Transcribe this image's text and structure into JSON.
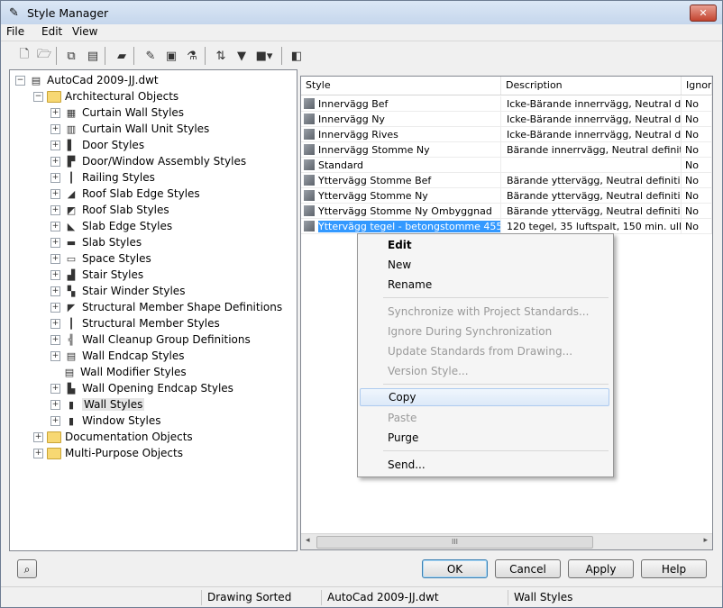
{
  "window": {
    "title": "Style Manager",
    "close_label": "✕"
  },
  "menu": [
    "File",
    "Edit",
    "View"
  ],
  "tree": {
    "root": "AutoCad 2009-JJ.dwt",
    "architectural": "Architectural Objects",
    "items": [
      "Curtain Wall Styles",
      "Curtain Wall Unit Styles",
      "Door Styles",
      "Door/Window Assembly Styles",
      "Railing Styles",
      "Roof Slab Edge Styles",
      "Roof Slab Styles",
      "Slab Edge Styles",
      "Slab Styles",
      "Space Styles",
      "Stair Styles",
      "Stair Winder Styles",
      "Structural Member Shape Definitions",
      "Structural Member Styles",
      "Wall Cleanup Group Definitions",
      "Wall Endcap Styles",
      "Wall Modifier Styles",
      "Wall Opening Endcap Styles",
      "Wall Styles",
      "Window Styles"
    ],
    "documentation": "Documentation Objects",
    "multipurpose": "Multi-Purpose Objects"
  },
  "list": {
    "columns": [
      "Style",
      "Description",
      "Ignor"
    ],
    "rows": [
      [
        "Innervägg Bef",
        "Icke-Bärande innerrvägg, Neutral d...",
        "No"
      ],
      [
        "Innervägg Ny",
        "Icke-Bärande innerrvägg, Neutral d...",
        "No"
      ],
      [
        "Innervägg Rives",
        "Icke-Bärande innerrvägg, Neutral d...",
        "No"
      ],
      [
        "Innervägg Stomme  Ny",
        "Bärande innerrvägg, Neutral definition",
        "No"
      ],
      [
        "Standard",
        "",
        "No"
      ],
      [
        "Yttervägg Stomme Bef",
        "Bärande yttervägg, Neutral definition",
        "No"
      ],
      [
        "Yttervägg Stomme Ny",
        "Bärande yttervägg, Neutral definition",
        "No"
      ],
      [
        "Yttervägg Stomme Ny Ombyggnad",
        "Bärande yttervägg, Neutral definition",
        "No"
      ],
      [
        "Yttervägg tegel - betongstomme 455",
        "120 tegel, 35 luftspalt, 150 min. ull, ...",
        "No"
      ]
    ],
    "scroll_grip": "III"
  },
  "context_menu": {
    "edit": "Edit",
    "new": "New",
    "rename": "Rename",
    "sync_project": "Synchronize with Project Standards...",
    "ignore_sync": "Ignore During Synchronization",
    "update_standards": "Update Standards from Drawing...",
    "version_style": "Version Style...",
    "copy": "Copy",
    "paste": "Paste",
    "purge": "Purge",
    "send": "Send..."
  },
  "buttons": {
    "ok": "OK",
    "cancel": "Cancel",
    "apply": "Apply",
    "help": "Help"
  },
  "status": {
    "sort": "Drawing Sorted",
    "file": "AutoCad 2009-JJ.dwt",
    "category": "Wall Styles"
  },
  "colors": {
    "selection": "#3399ff",
    "title_bar": "#c5d6ec",
    "close_button": "#c3442f"
  }
}
